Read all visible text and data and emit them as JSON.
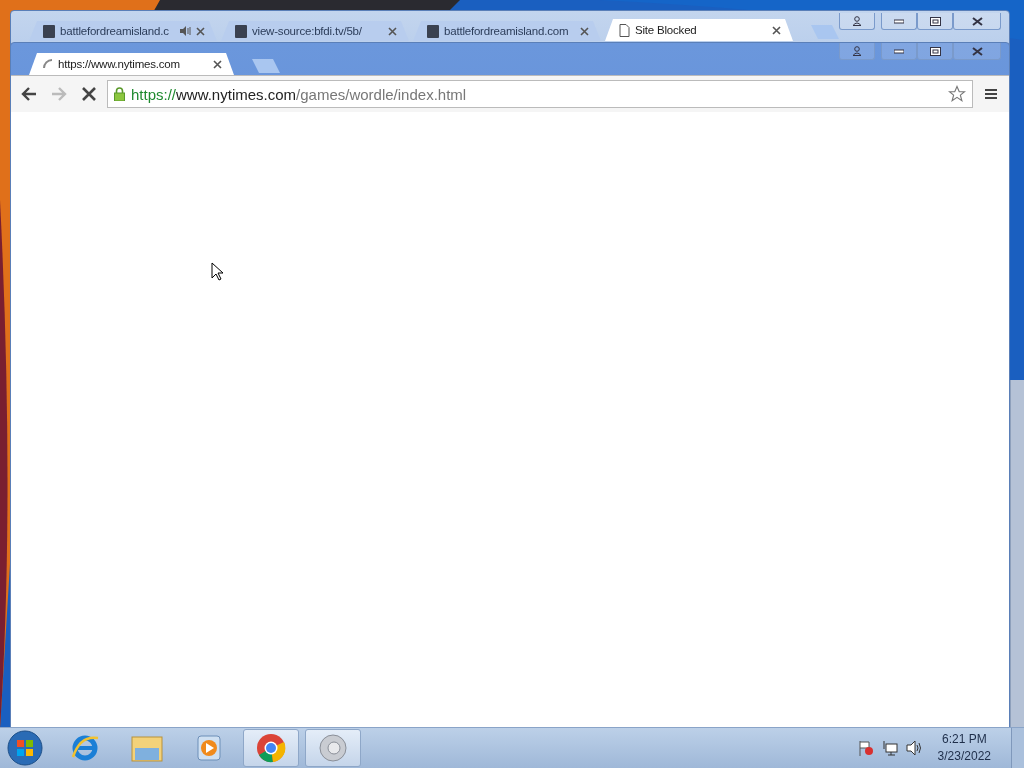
{
  "back_window": {
    "tabs": [
      {
        "title": "battlefordreamisland.c",
        "kind": "site",
        "audio": true,
        "selected": false
      },
      {
        "title": "view-source:bfdi.tv/5b/",
        "kind": "site",
        "audio": false,
        "selected": false
      },
      {
        "title": "battlefordreamisland.com",
        "kind": "site",
        "audio": false,
        "selected": false
      },
      {
        "title": "Site Blocked",
        "kind": "page",
        "audio": false,
        "selected": true
      }
    ]
  },
  "front_window": {
    "tabs": [
      {
        "title": "https://www.nytimes.com",
        "loading": true,
        "selected": true
      }
    ],
    "toolbar": {
      "back_disabled": false,
      "forward_disabled": true,
      "loading": true
    },
    "address": {
      "secure": true,
      "scheme": "https://",
      "host": "www.nytimes.com",
      "path": "/games/wordle/index.html"
    }
  },
  "taskbar": {
    "items": [
      {
        "kind": "ie",
        "active": false
      },
      {
        "kind": "explorer",
        "active": false
      },
      {
        "kind": "media",
        "active": false
      },
      {
        "kind": "chrome",
        "active": true
      },
      {
        "kind": "sound",
        "active": true
      }
    ],
    "tray": {
      "time": "6:21 PM",
      "date": "3/23/2022"
    }
  }
}
